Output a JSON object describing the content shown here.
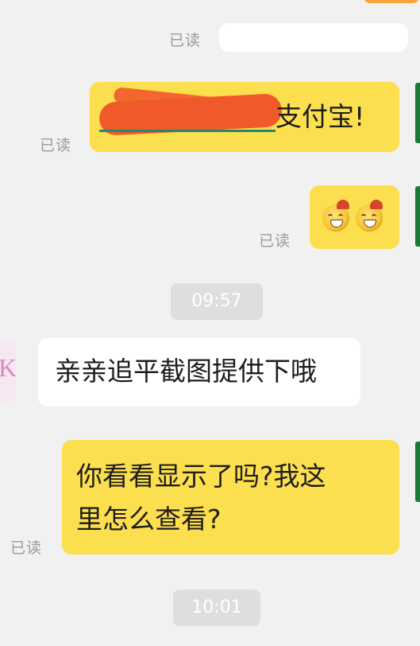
{
  "messages": {
    "read_label": "已读",
    "msg2_visible_text": "支付宝!",
    "time_1": "09:57",
    "incoming_text": "亲亲追平截图提供下哦",
    "incoming_avatar_text": "K",
    "outgoing_line1": "你看看显示了吗?我这",
    "outgoing_line2": "里怎么查看?",
    "time_2": "10:01"
  },
  "colors": {
    "background": "#f1f1f1",
    "outgoing_bubble": "#fcdf4e",
    "incoming_bubble": "#ffffff",
    "time_pill": "#dedede",
    "redaction": "#f05a2a"
  },
  "icons": [
    "laughing-emoji-icon",
    "laughing-emoji-icon"
  ]
}
